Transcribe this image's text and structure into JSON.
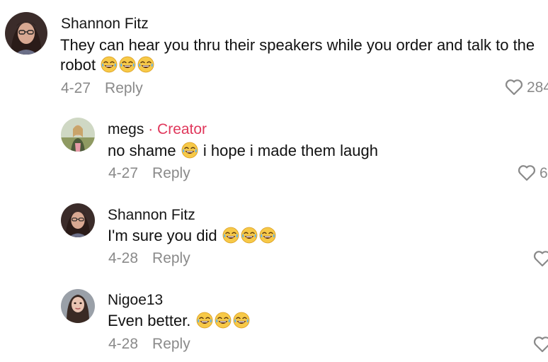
{
  "comments": [
    {
      "author": "Shannon Fitz",
      "badge": "",
      "text_lines": [
        "They can hear you thru their speakers while you order and talk to the",
        "robot"
      ],
      "emoji_after_text": [
        "joy-emoji",
        "joy-emoji",
        "joy-emoji"
      ],
      "date": "4-27",
      "reply_label": "Reply",
      "likes": "284"
    },
    {
      "author": "megs",
      "badge": "· Creator",
      "text_before": "no shame",
      "text_after": "i hope i made them laugh",
      "date": "4-27",
      "reply_label": "Reply",
      "likes": "6"
    },
    {
      "author": "Shannon Fitz",
      "badge": "",
      "text": "I'm sure you did",
      "date": "4-28",
      "reply_label": "Reply",
      "likes": ""
    },
    {
      "author": "Nigoe13",
      "badge": "",
      "text": "Even better.",
      "date": "4-28",
      "reply_label": "Reply",
      "likes": ""
    }
  ],
  "colors": {
    "creator_badge": "#e0385c",
    "meta_text": "#8a8a8a",
    "body_text": "#111111"
  },
  "icons": {
    "emoji": "face-with-tears-of-joy",
    "like": "heart-outline-icon"
  }
}
